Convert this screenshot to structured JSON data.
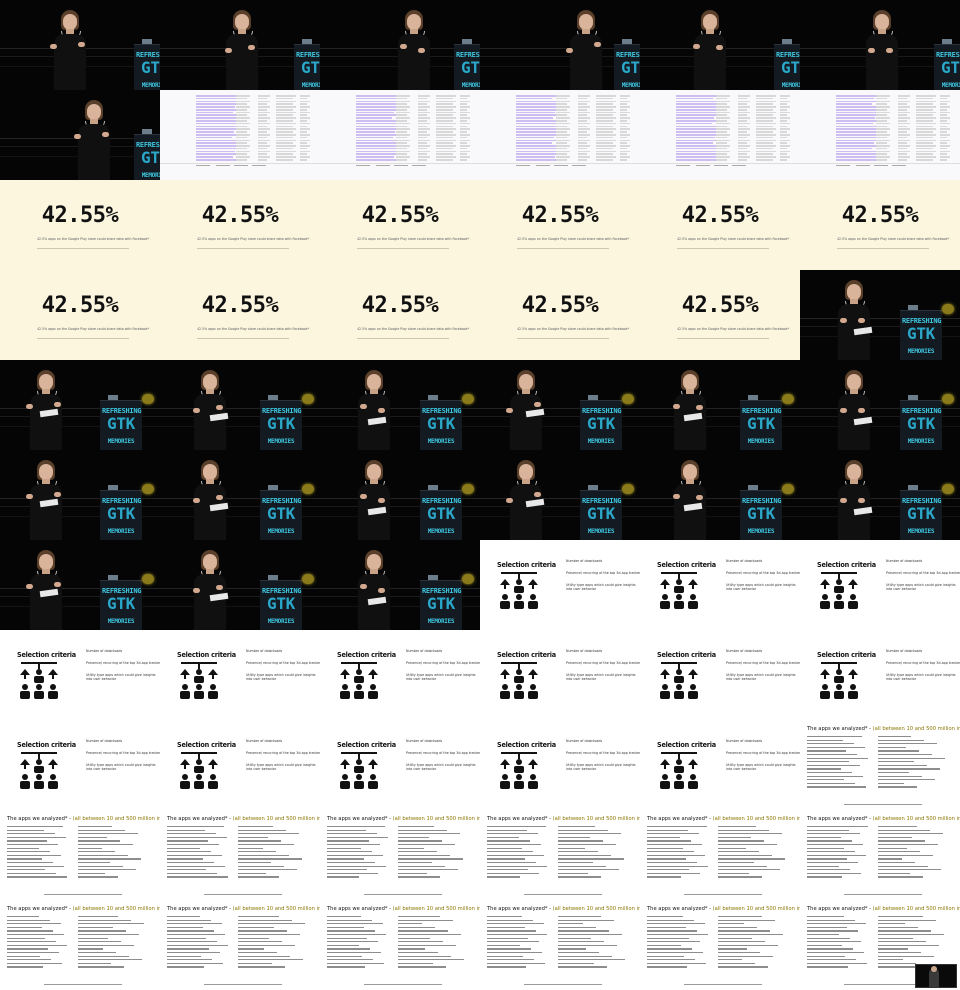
{
  "grid": {
    "columns": 6,
    "rows": 11
  },
  "labels": {
    "podium_line1": "REFRESHING",
    "podium_line2": "GTK",
    "podium_line3": "MEMORIES",
    "stat_value": "42.55%",
    "stat_caption": "42.5% apps on the Google Play store could share data with Facebook*",
    "criteria_title": "Selection criteria",
    "criteria_b1": "Number of downloads",
    "criteria_b2": "Presence/ recurring of the top 3d-app tracker",
    "criteria_b3": "Utility type apps which could give insights into user behavior",
    "apps_title": "The apps we analyzed* - ",
    "apps_title_highlight": "(all between 10 and 500 million installs each)"
  },
  "frames": [
    "speaker",
    "speaker",
    "speaker",
    "speaker",
    "speaker",
    "speaker",
    "speaker",
    "spreadsheet",
    "spreadsheet",
    "spreadsheet",
    "spreadsheet",
    "spreadsheet",
    "stat",
    "stat",
    "stat",
    "stat",
    "stat",
    "stat",
    "stat",
    "stat",
    "stat",
    "stat",
    "stat",
    "speaker",
    "speaker",
    "speaker",
    "speaker",
    "speaker",
    "speaker",
    "speaker",
    "speaker",
    "speaker",
    "speaker",
    "speaker",
    "speaker",
    "speaker",
    "speaker",
    "speaker",
    "speaker",
    "criteria",
    "criteria",
    "criteria",
    "criteria",
    "criteria",
    "criteria",
    "criteria",
    "criteria",
    "criteria",
    "criteria",
    "criteria",
    "criteria",
    "criteria",
    "criteria",
    "apps",
    "apps",
    "apps",
    "apps",
    "apps",
    "apps",
    "apps",
    "apps",
    "apps",
    "apps",
    "apps",
    "apps",
    "apps"
  ]
}
